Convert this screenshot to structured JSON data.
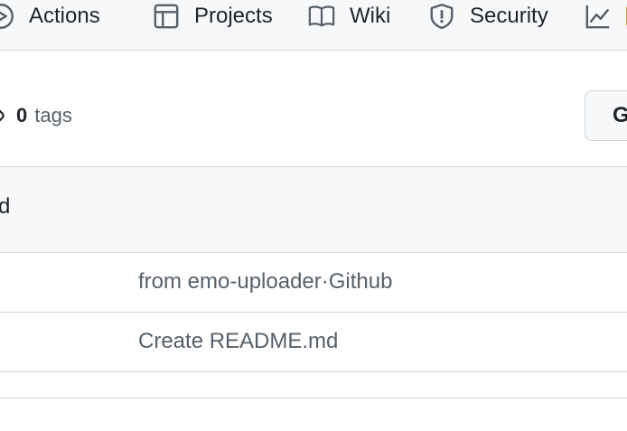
{
  "nav": {
    "items": [
      {
        "label": "Actions",
        "icon": "play-circle-icon"
      },
      {
        "label": "Projects",
        "icon": "table-icon"
      },
      {
        "label": "Wiki",
        "icon": "book-icon"
      },
      {
        "label": "Security",
        "icon": "shield-icon"
      },
      {
        "label": "",
        "icon": "graph-icon"
      }
    ]
  },
  "repo": {
    "tags_count": "0",
    "tags_label": "tags",
    "button_label": "G"
  },
  "files": {
    "header_fragment": "d",
    "rows": [
      {
        "message": "from emo-uploader·Github"
      },
      {
        "message": "Create README.md"
      }
    ]
  },
  "colors": {
    "nav_bg": "#f6f8fa",
    "border": "#d0d7de",
    "text": "#1f2328",
    "muted": "#57606a",
    "accent_partial": "#d4a72c"
  }
}
